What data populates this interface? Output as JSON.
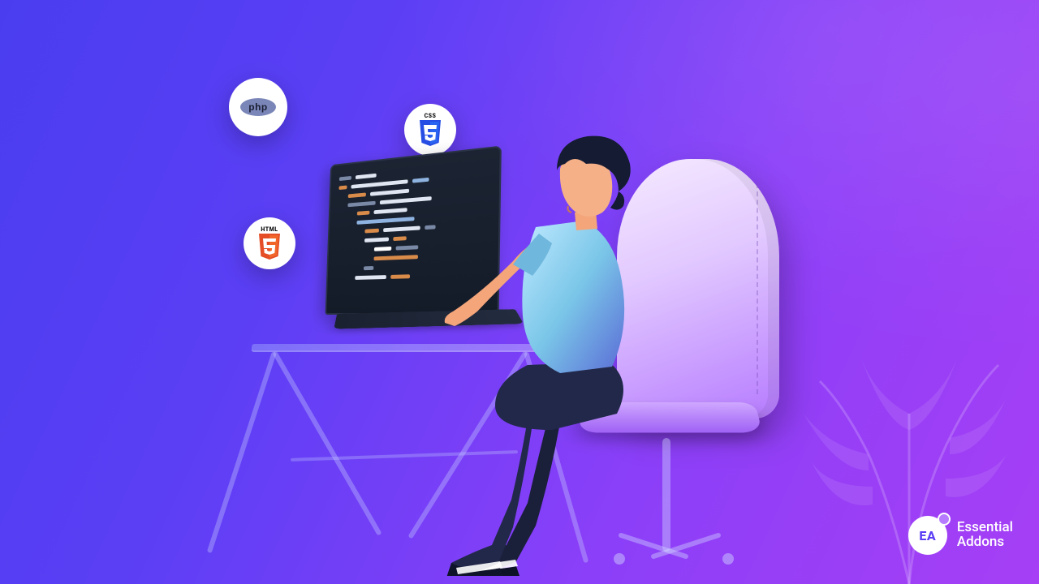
{
  "badges": {
    "php": {
      "label": "php"
    },
    "css": {
      "label": "CSS"
    },
    "html": {
      "label": "HTML"
    }
  },
  "brand": {
    "mark": "EA",
    "line1": "Essential",
    "line2": "Addons"
  }
}
